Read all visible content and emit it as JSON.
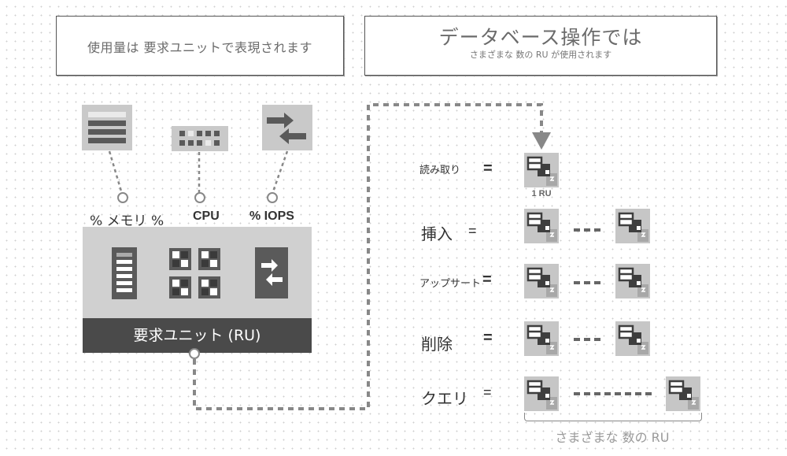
{
  "header_left": {
    "text": "使用量は 要求ユニットで表現されます"
  },
  "header_right": {
    "title": "データベース操作では",
    "subtitle": "さまざまな 数の RU が使用されます"
  },
  "resources": [
    {
      "name": "memory",
      "label": "% メモリ %",
      "icon": "memory-icon"
    },
    {
      "name": "cpu",
      "label": "CPU",
      "icon": "cpu-icon"
    },
    {
      "name": "iops",
      "label": "% IOPS",
      "icon": "iops-icon"
    }
  ],
  "request_unit": {
    "label": "要求ユニット (RU)"
  },
  "operations": [
    {
      "label": "読み取り",
      "eq": "=",
      "ru_caption": "1 RU",
      "icons": 1
    },
    {
      "label": "挿入",
      "eq": "=",
      "icons": 2
    },
    {
      "label": "アップサート",
      "eq": "=",
      "icons": 2
    },
    {
      "label": "削除",
      "eq": "=",
      "icons": 2
    },
    {
      "label": "クエリ",
      "eq": "=",
      "icons": 2
    }
  ],
  "varying_label": "さまざまな 数の RU",
  "colors": {
    "dark": "#4a4a4a",
    "tile": "#c9c9c9",
    "connector": "#888888"
  }
}
